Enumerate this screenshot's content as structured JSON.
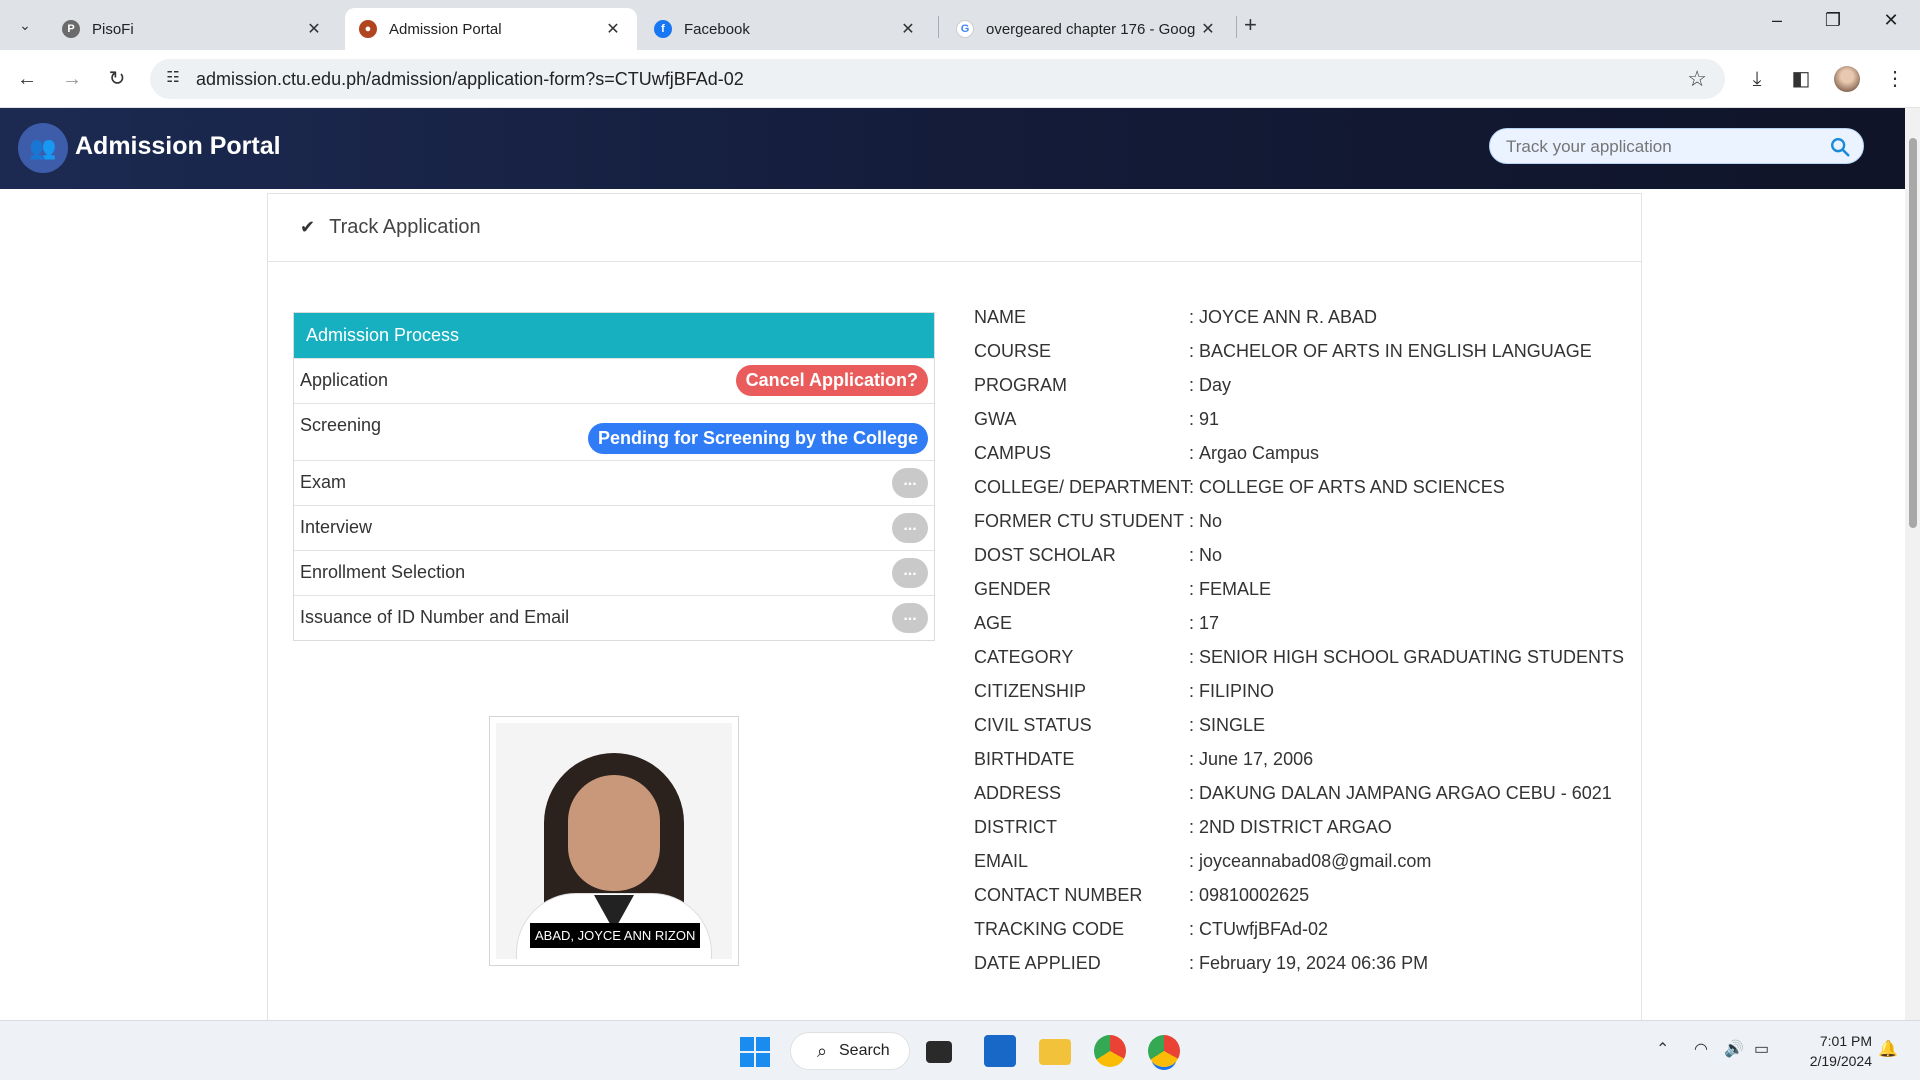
{
  "browser": {
    "tabs": [
      {
        "title": "PisoFi",
        "active": false
      },
      {
        "title": "Admission Portal",
        "active": true
      },
      {
        "title": "Facebook",
        "active": false
      },
      {
        "title": "overgeared chapter 176 - Goog",
        "active": false
      }
    ],
    "url": "admission.ctu.edu.ph/admission/application-form?s=CTUwfjBFAd-02"
  },
  "header": {
    "brand": "Admission Portal",
    "search_placeholder": "Track your application"
  },
  "card": {
    "title": "Track Application"
  },
  "process": {
    "heading": "Admission Process",
    "steps": [
      {
        "label": "Application",
        "status": "Cancel Application?"
      },
      {
        "label": "Screening",
        "status": "Pending for Screening by the College"
      },
      {
        "label": "Exam",
        "status": "..."
      },
      {
        "label": "Interview",
        "status": "..."
      },
      {
        "label": "Enrollment Selection",
        "status": "..."
      },
      {
        "label": "Issuance of ID Number and Email",
        "status": "..."
      }
    ],
    "colors": {
      "header": "#17b0c1",
      "cancel": "#ea5c5c",
      "pending": "#2f7cf6",
      "idle": "#c9c9c9"
    }
  },
  "photo": {
    "caption": "ABAD, JOYCE ANN RIZON"
  },
  "details": [
    {
      "label": "NAME",
      "value": "JOYCE ANN R. ABAD"
    },
    {
      "label": "COURSE",
      "value": "BACHELOR OF ARTS IN ENGLISH LANGUAGE"
    },
    {
      "label": "PROGRAM",
      "value": "Day"
    },
    {
      "label": "GWA",
      "value": "91"
    },
    {
      "label": "CAMPUS",
      "value": "Argao Campus"
    },
    {
      "label": "COLLEGE/ DEPARTMENT",
      "value": "COLLEGE OF ARTS AND SCIENCES"
    },
    {
      "label": "FORMER CTU STUDENT",
      "value": "No"
    },
    {
      "label": "DOST SCHOLAR",
      "value": "No"
    },
    {
      "label": "GENDER",
      "value": "FEMALE"
    },
    {
      "label": "AGE",
      "value": "17"
    },
    {
      "label": "CATEGORY",
      "value": "SENIOR HIGH SCHOOL GRADUATING STUDENTS"
    },
    {
      "label": "CITIZENSHIP",
      "value": "FILIPINO"
    },
    {
      "label": "CIVIL STATUS",
      "value": "SINGLE"
    },
    {
      "label": "BIRTHDATE",
      "value": "June 17, 2006"
    },
    {
      "label": "ADDRESS",
      "value": "DAKUNG DALAN JAMPANG ARGAO CEBU - 6021"
    },
    {
      "label": "DISTRICT",
      "value": "2ND DISTRICT ARGAO"
    },
    {
      "label": "EMAIL",
      "value": "joyceannabad08@gmail.com"
    },
    {
      "label": "CONTACT NUMBER",
      "value": "09810002625"
    },
    {
      "label": "TRACKING CODE",
      "value": "CTUwfjBFAd-02"
    },
    {
      "label": "DATE APPLIED",
      "value": "February 19, 2024 06:36 PM"
    }
  ],
  "taskbar": {
    "search_label": "Search",
    "time": "7:01 PM",
    "date": "2/19/2024"
  }
}
